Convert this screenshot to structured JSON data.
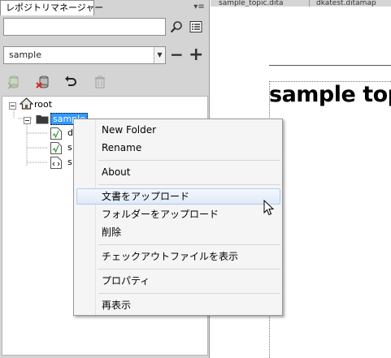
{
  "panel": {
    "title": "レポジトリマネージャー",
    "menu_glyph": "▾≡",
    "search": {
      "value": "",
      "placeholder": ""
    },
    "repo_select": {
      "value": "sample"
    },
    "toolbar": [
      "checkout-icon",
      "delete-repo-icon",
      "undo-icon",
      "trash-icon"
    ],
    "tree": {
      "root_label": "root",
      "selected_label": "sample",
      "children": [
        "d",
        "s",
        "s"
      ]
    }
  },
  "editor": {
    "tabs": [
      "sample_topic.dita",
      "dkatest.ditamap"
    ],
    "doc_title": "sample top"
  },
  "context_menu": {
    "items": [
      "New Folder",
      "Rename",
      "About",
      "文書をアップロード",
      "フォルダーをアップロード",
      "削除",
      "チェックアウトファイルを表示",
      "プロパティ",
      "再表示"
    ],
    "highlighted_index": 3
  },
  "colors": {
    "panel_bg": "#d4d4d4",
    "selection": "#3399ff",
    "menu_bg": "#f5f5f5",
    "highlight_border": "#aeccee"
  }
}
